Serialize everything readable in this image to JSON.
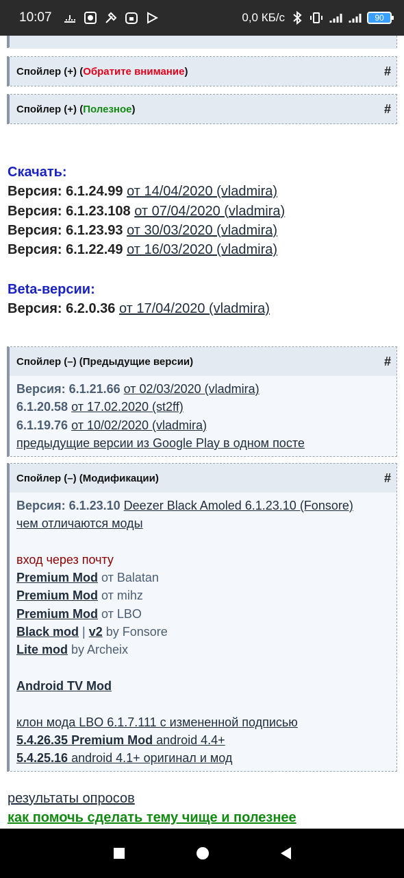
{
  "status": {
    "time": "10:07",
    "speed": "0,0 КБ/с",
    "battery": "90"
  },
  "spoilers_top": [
    {
      "prefix": "Спойлер (+) (",
      "label": "Обратите внимание",
      "suffix": ")",
      "hash": "#"
    },
    {
      "prefix": "Спойлер (+) (",
      "label": "Полезное",
      "suffix": ")",
      "hash": "#"
    }
  ],
  "download": {
    "heading": "Скачать:",
    "items": [
      {
        "ver": "Версия: 6.1.24.99",
        "link": "от 14/04/2020 (vladmira)"
      },
      {
        "ver": "Версия: 6.1.23.108",
        "link": "от 07/04/2020 (vladmira)"
      },
      {
        "ver": "Версия: 6.1.23.93",
        "link": "от 30/03/2020 (vladmira)"
      },
      {
        "ver": "Версия: 6.1.22.49",
        "link": "от 16/03/2020 (vladmira)"
      }
    ]
  },
  "beta": {
    "heading": "Beta-версии:",
    "items": [
      {
        "ver": "Версия: 6.2.0.36",
        "link": "от 17/04/2020 (vladmira)"
      }
    ]
  },
  "prev": {
    "title": "Спойлер (–) (Предыдущие версии)",
    "hash": "#",
    "rows": [
      {
        "ver": "Версия: 6.1.21.66",
        "link": "от 02/03/2020 (vladmira)"
      },
      {
        "ver": "6.1.20.58",
        "link": "от 17.02.2020 (st2ff)"
      },
      {
        "ver": "6.1.19.76",
        "link": "от 10/02/2020 (vladmira)"
      }
    ],
    "gp": "предыдущие версии из Google Play в одном посте"
  },
  "mods": {
    "title": "Спойлер (–) (Модификации)",
    "hash": "#",
    "ver_label": "Версия: 6.1.23.10",
    "ver_link": "Deezer Black Amoled 6.1.23.10 (Fonsore)",
    "diff": "чем отличаются моды",
    "email_login": "вход через почту",
    "premium1": {
      "name": "Premium Mod",
      "by": "от Balatan"
    },
    "premium2": {
      "name": "Premium Mod",
      "by": "от mihz"
    },
    "premium3": {
      "name": "Premium Mod",
      "by": "от LBO"
    },
    "black": {
      "name": "Black mod",
      "sep": " | ",
      "v2": "v2",
      "by": " by Fonsore"
    },
    "lite": {
      "name": "Lite mod",
      "by": " by Archeix"
    },
    "tv": "Android TV Mod",
    "clone": "клон мода LBO 6.1.7.111 с измененной подписью",
    "old1": {
      "ver": "5.4.26.35 Premium Mod",
      "text": " android 4.4+"
    },
    "old2": {
      "ver": "5.4.25.16",
      "text": " android 4.1+ оригинал и мод"
    }
  },
  "footer": {
    "polls": "результаты опросов",
    "help": "как помочь сделать тему чище и полезнее"
  }
}
